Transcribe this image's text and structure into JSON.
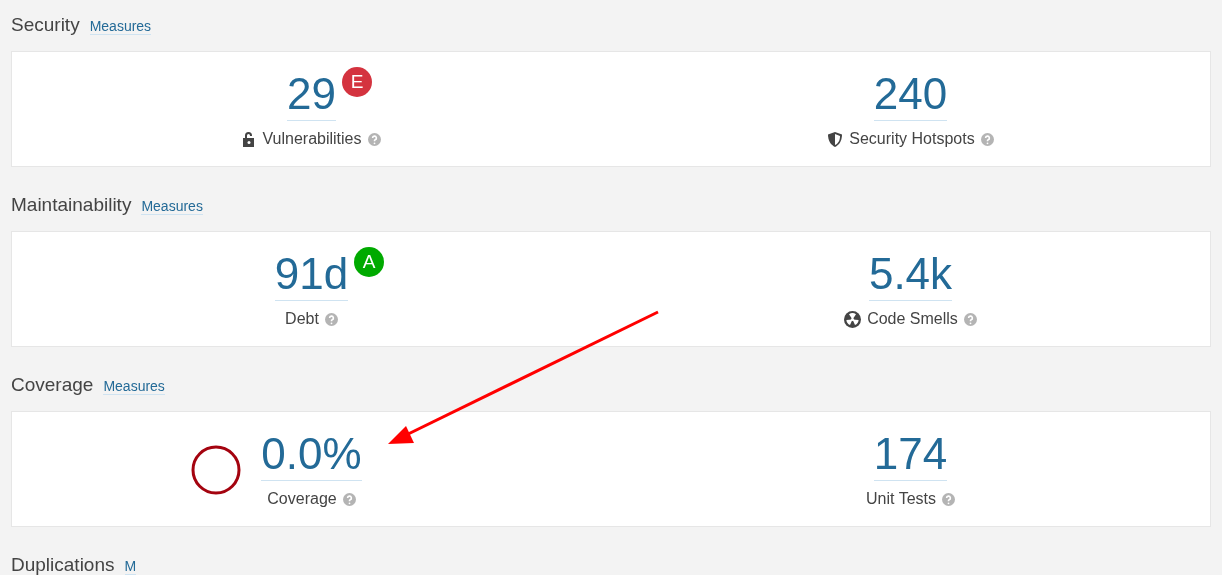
{
  "sections": [
    {
      "title": "Security",
      "link": "Measures",
      "metrics": [
        {
          "kind": "vulnerabilities",
          "value": "29",
          "rating": {
            "letter": "E",
            "color": "#d4333f"
          },
          "label": "Vulnerabilities"
        },
        {
          "kind": "hotspots",
          "value": "240",
          "label": "Security Hotspots"
        }
      ]
    },
    {
      "title": "Maintainability",
      "link": "Measures",
      "metrics": [
        {
          "kind": "debt",
          "value": "91d",
          "rating": {
            "letter": "A",
            "color": "#00aa00"
          },
          "label": "Debt"
        },
        {
          "kind": "smells",
          "value": "5.4k",
          "label": "Code Smells"
        }
      ]
    },
    {
      "title": "Coverage",
      "link": "Measures",
      "metrics": [
        {
          "kind": "coverage",
          "value": "0.0%",
          "label": "Coverage"
        },
        {
          "kind": "tests",
          "value": "174",
          "label": "Unit Tests"
        }
      ]
    },
    {
      "title": "Duplications",
      "link": "M"
    }
  ]
}
